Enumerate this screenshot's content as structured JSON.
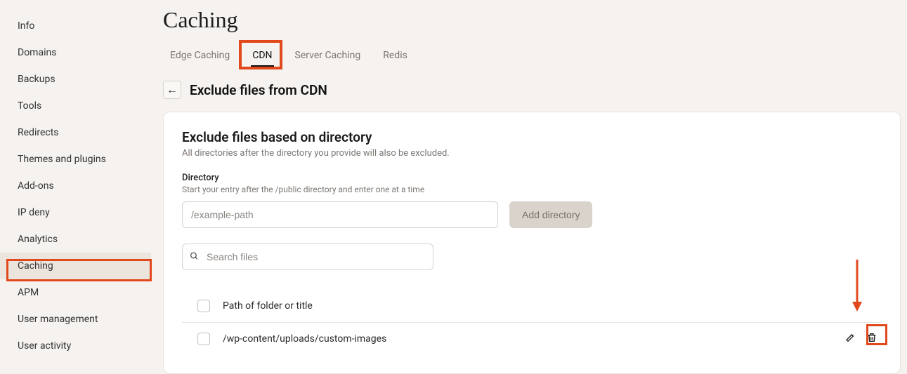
{
  "sidebar": {
    "items": [
      {
        "label": "Info"
      },
      {
        "label": "Domains"
      },
      {
        "label": "Backups"
      },
      {
        "label": "Tools"
      },
      {
        "label": "Redirects"
      },
      {
        "label": "Themes and plugins"
      },
      {
        "label": "Add-ons"
      },
      {
        "label": "IP deny"
      },
      {
        "label": "Analytics"
      },
      {
        "label": "Caching"
      },
      {
        "label": "APM"
      },
      {
        "label": "User management"
      },
      {
        "label": "User activity"
      }
    ],
    "active_index": 9
  },
  "page": {
    "title": "Caching"
  },
  "tabs": {
    "items": [
      {
        "label": "Edge Caching"
      },
      {
        "label": "CDN"
      },
      {
        "label": "Server Caching"
      },
      {
        "label": "Redis"
      }
    ],
    "active_index": 1
  },
  "back": {
    "glyph": "←",
    "title": "Exclude files from CDN"
  },
  "panel": {
    "heading": "Exclude files based on directory",
    "subtext": "All directories after the directory you provide will also be excluded.",
    "directory_label": "Directory",
    "directory_hint": "Start your entry after the /public directory and enter one at a time",
    "directory_placeholder": "/example-path",
    "add_button": "Add directory",
    "search_placeholder": "Search files",
    "header_label": "Path of folder or title",
    "rows": [
      {
        "path": "/wp-content/uploads/custom-images"
      }
    ]
  },
  "colors": {
    "highlight": "#e1491c"
  }
}
